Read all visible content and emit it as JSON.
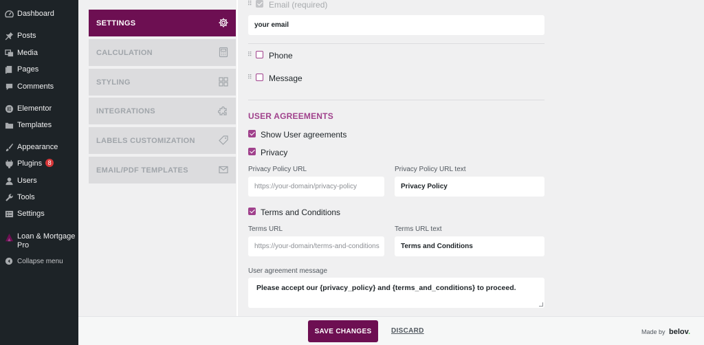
{
  "sidebar": {
    "items": [
      {
        "label": "Dashboard",
        "icon": "dashboard-icon"
      },
      {
        "label": "Posts",
        "icon": "pin-icon"
      },
      {
        "label": "Media",
        "icon": "media-icon"
      },
      {
        "label": "Pages",
        "icon": "pages-icon"
      },
      {
        "label": "Comments",
        "icon": "comments-icon"
      },
      {
        "label": "Elementor",
        "icon": "elementor-icon"
      },
      {
        "label": "Templates",
        "icon": "folder-icon"
      },
      {
        "label": "Appearance",
        "icon": "brush-icon"
      },
      {
        "label": "Plugins",
        "icon": "plugin-icon",
        "badge": "8"
      },
      {
        "label": "Users",
        "icon": "user-icon"
      },
      {
        "label": "Tools",
        "icon": "wrench-icon"
      },
      {
        "label": "Settings",
        "icon": "settings-icon"
      },
      {
        "label": "Loan & Mortgage",
        "label2": "Pro",
        "icon": "calculator-logo-icon"
      },
      {
        "label": "Collapse menu",
        "icon": "collapse-icon"
      }
    ]
  },
  "tabs": [
    {
      "label": "SETTINGS",
      "icon": "gear-icon",
      "active": true
    },
    {
      "label": "CALCULATION",
      "icon": "calculator-icon",
      "active": false
    },
    {
      "label": "STYLING",
      "icon": "grid-icon",
      "active": false
    },
    {
      "label": "INTEGRATIONS",
      "icon": "puzzle-icon",
      "active": false
    },
    {
      "label": "LABELS CUSTOMIZATION",
      "icon": "tag-icon",
      "active": false
    },
    {
      "label": "EMAIL/PDF TEMPLATES",
      "icon": "envelope-icon",
      "active": false
    }
  ],
  "form": {
    "email_label": "Email (required)",
    "email_value": "your email",
    "phone_label": "Phone",
    "message_label": "Message",
    "agreements_title": "USER AGREEMENTS",
    "show_agreements_label": "Show User agreements",
    "privacy_label": "Privacy",
    "privacy_url_label": "Privacy Policy URL",
    "privacy_url_placeholder": "https://your-domain/privacy-policy",
    "privacy_text_label": "Privacy Policy URL text",
    "privacy_text_value": "Privacy Policy",
    "terms_label": "Terms and Conditions",
    "terms_url_label": "Terms URL",
    "terms_url_placeholder": "https://your-domain/terms-and-conditions",
    "terms_text_label": "Terms URL text",
    "terms_text_value": "Terms and Conditions",
    "agreement_msg_label": "User agreement message",
    "agreement_msg_value": "Please accept our {privacy_policy} and {terms_and_conditions} to proceed.",
    "checkboxes": {
      "email": true,
      "phone": false,
      "message": false,
      "show_agreements": true,
      "privacy": true,
      "terms": true
    }
  },
  "footer": {
    "save_label": "SAVE CHANGES",
    "discard_label": "DISCARD",
    "made_by": "Made by",
    "brand": "belov",
    "brand_dot": "."
  },
  "colors": {
    "accent": "#6d0f52",
    "checkbox": "#a0418c",
    "sidebar_bg": "#1d2327"
  }
}
